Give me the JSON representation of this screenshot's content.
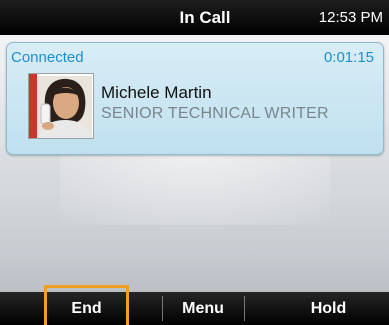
{
  "status_bar": {
    "title": "In Call",
    "time": "12:53 PM"
  },
  "call": {
    "state": "Connected",
    "duration": "0:01:15",
    "contact_name": "Michele Martin",
    "contact_title": "SENIOR TECHNICAL WRITER"
  },
  "softkeys": {
    "end": "End",
    "menu": "Menu",
    "hold": "Hold"
  },
  "colors": {
    "accent": "#1e8fce",
    "focus": "#f0a020",
    "avatar_stripe": "#c8372c"
  }
}
